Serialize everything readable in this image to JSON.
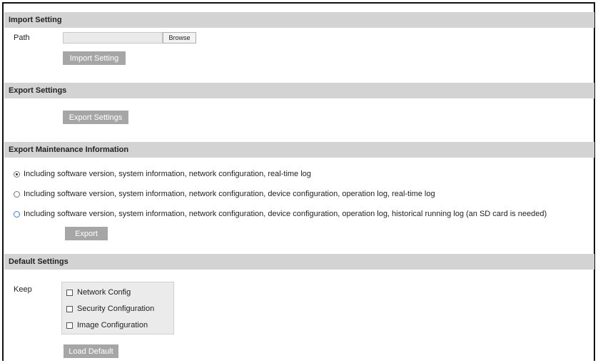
{
  "import": {
    "header": "Import Setting",
    "path_label": "Path",
    "path_value": "",
    "browse_label": "Browse",
    "button_label": "Import Setting"
  },
  "export": {
    "header": "Export Settings",
    "button_label": "Export Settings"
  },
  "maintenance": {
    "header": "Export Maintenance Information",
    "options": [
      {
        "label": "Including software version, system information, network configuration, real-time log",
        "selected": true
      },
      {
        "label": "Including software version, system information, network configuration, device configuration, operation log, real-time log",
        "selected": false
      },
      {
        "label": "Including software version, system information, network configuration, device configuration, operation log, historical running log (an SD card is needed)",
        "selected": false
      }
    ],
    "button_label": "Export"
  },
  "defaults": {
    "header": "Default Settings",
    "keep_label": "Keep",
    "options": [
      {
        "label": "Network Config",
        "checked": false
      },
      {
        "label": "Security Configuration",
        "checked": false
      },
      {
        "label": "Image Configuration",
        "checked": false
      }
    ],
    "button_label": "Load Default"
  },
  "colors": {
    "header_bg": "#d3d3d3",
    "button_bg": "#a6a6a6",
    "radio_accent": "#3d7ed8"
  }
}
